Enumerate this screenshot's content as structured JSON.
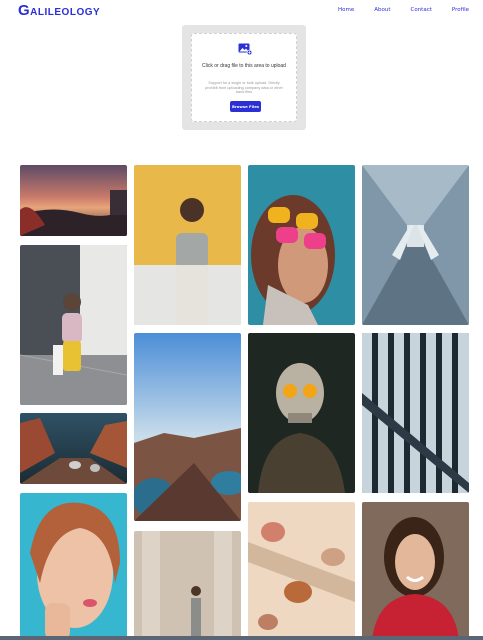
{
  "header": {
    "logo_first": "G",
    "logo_rest": "ALILEOLOGY",
    "nav": [
      "Home",
      "About",
      "Contact",
      "Profile"
    ]
  },
  "upload": {
    "title": "Click or drag file to this area to upload",
    "description": "Support for a single or bulk upload. Strictly prohibit from uploading company data or other band files",
    "button_label": "Browse Files"
  },
  "colors": {
    "accent": "#2b2fd6"
  },
  "gallery": [
    {
      "subject": "sunset coastline"
    },
    {
      "subject": "toddler with bag"
    },
    {
      "subject": "desert canyon road"
    },
    {
      "subject": "girl with freckles"
    },
    {
      "subject": "woman yellow wall"
    },
    {
      "subject": "coastal bay aerial"
    },
    {
      "subject": "woman marble columns"
    },
    {
      "subject": "woman pink yellow sunglasses"
    },
    {
      "subject": "glowing skull"
    },
    {
      "subject": "wine glasses shadows"
    },
    {
      "subject": "escalators"
    },
    {
      "subject": "architectural stripes"
    },
    {
      "subject": "smiling woman red top"
    }
  ]
}
